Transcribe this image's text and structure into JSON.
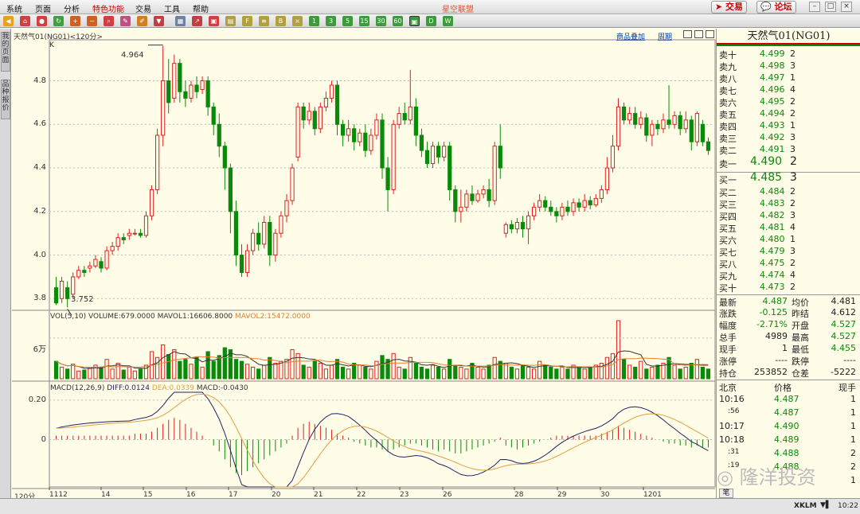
{
  "menu": {
    "items": [
      "系统",
      "页面",
      "分析",
      "特色功能",
      "交易",
      "工具",
      "帮助"
    ],
    "title": "星空联盟",
    "trade_btn": "交易",
    "forum_btn": "论坛"
  },
  "left_tabs": [
    "我的页面",
    "品种报价"
  ],
  "chart": {
    "title": "天然气01(NG01)<120分>",
    "k_label": "K",
    "links": [
      "商品叠加",
      "周期"
    ],
    "high_label": "4.964",
    "low_label": "3.752",
    "period_label": "120分",
    "price_ticks": [
      "4.8",
      "4.6",
      "4.4",
      "4.2",
      "4.0",
      "3.8"
    ],
    "x_labels": [
      "1112",
      "14",
      "15",
      "16",
      "17",
      "20",
      "21",
      "22",
      "23",
      "26",
      "28",
      "29",
      "30",
      "1201"
    ]
  },
  "volume": {
    "header_vol": "VOL(5,10) VOLUME:679.0000",
    "header_mavol1": "MAVOL1:16606.8000",
    "header_mavol2": "MAVOL2:15472.0000",
    "tick": "6万"
  },
  "macd": {
    "header_name": "MACD(12,26,9)",
    "header_diff": "DIFF:0.0124",
    "header_dea": "DEA:0.0339",
    "header_macd": "MACD:-0.0430",
    "ticks": [
      "0.20",
      "0"
    ]
  },
  "quote": {
    "title": "天然气01(NG01)",
    "sell": [
      {
        "label": "卖十",
        "price": "4.499",
        "qty": "2"
      },
      {
        "label": "卖九",
        "price": "4.498",
        "qty": "3"
      },
      {
        "label": "卖八",
        "price": "4.497",
        "qty": "1"
      },
      {
        "label": "卖七",
        "price": "4.496",
        "qty": "4"
      },
      {
        "label": "卖六",
        "price": "4.495",
        "qty": "2"
      },
      {
        "label": "卖五",
        "price": "4.494",
        "qty": "2"
      },
      {
        "label": "卖四",
        "price": "4.493",
        "qty": "1"
      },
      {
        "label": "卖三",
        "price": "4.492",
        "qty": "3"
      },
      {
        "label": "卖二",
        "price": "4.491",
        "qty": "3"
      },
      {
        "label": "卖一",
        "price": "4.490",
        "qty": "2"
      }
    ],
    "buy": [
      {
        "label": "买一",
        "price": "4.485",
        "qty": "3"
      },
      {
        "label": "买二",
        "price": "4.484",
        "qty": "2"
      },
      {
        "label": "买三",
        "price": "4.483",
        "qty": "2"
      },
      {
        "label": "买四",
        "price": "4.482",
        "qty": "3"
      },
      {
        "label": "买五",
        "price": "4.481",
        "qty": "4"
      },
      {
        "label": "买六",
        "price": "4.480",
        "qty": "1"
      },
      {
        "label": "买七",
        "price": "4.479",
        "qty": "3"
      },
      {
        "label": "买八",
        "price": "4.475",
        "qty": "2"
      },
      {
        "label": "买九",
        "price": "4.474",
        "qty": "4"
      },
      {
        "label": "买十",
        "price": "4.473",
        "qty": "2"
      }
    ],
    "stats": [
      {
        "l1": "最新",
        "v1": "4.487",
        "l2": "均价",
        "v2": "4.481"
      },
      {
        "l1": "涨跌",
        "v1": "-0.125",
        "l2": "昨结",
        "v2": "4.612"
      },
      {
        "l1": "幅度",
        "v1": "-2.71%",
        "l2": "开盘",
        "v2": "4.527"
      },
      {
        "l1": "总手",
        "v1": "4989",
        "l2": "最高",
        "v2": "4.527"
      },
      {
        "l1": "现手",
        "v1": "1",
        "l2": "最低",
        "v2": "4.455"
      },
      {
        "l1": "涨停",
        "v1": "----",
        "l2": "跌停",
        "v2": "----"
      },
      {
        "l1": "持仓",
        "v1": "253852",
        "l2": "仓差",
        "v2": "-5222"
      }
    ],
    "trades_header": {
      "time": "北京",
      "price": "价格",
      "qty": "现手"
    },
    "trades": [
      {
        "time": "10:16",
        "price": "4.487",
        "qty": "1"
      },
      {
        "time": ":56",
        "price": "4.487",
        "qty": "1"
      },
      {
        "time": "10:17",
        "price": "4.490",
        "qty": "1"
      },
      {
        "time": "10:18",
        "price": "4.489",
        "qty": "1"
      },
      {
        "time": ":31",
        "price": "4.488",
        "qty": "2"
      },
      {
        "time": ":19",
        "price": "4.488",
        "qty": "2"
      },
      {
        "time": "",
        "price": "",
        "qty": "1"
      }
    ],
    "tab": "笔"
  },
  "status": {
    "brand": "XKLM",
    "time": "10:22"
  },
  "watermark": "隆洋投资",
  "colors": {
    "up": "#e02020",
    "down": "#0a8a0a",
    "diff": "#222266",
    "dea": "#e0a040"
  },
  "chart_data": {
    "type": "candlestick",
    "price_ylim": [
      3.75,
      4.97
    ],
    "candles": [
      [
        3.85,
        3.78,
        3.9,
        3.77
      ],
      [
        3.8,
        3.88,
        3.9,
        3.78
      ],
      [
        3.85,
        3.8,
        3.88,
        3.76
      ],
      [
        3.82,
        3.9,
        3.92,
        3.8
      ],
      [
        3.9,
        3.93,
        3.95,
        3.89
      ],
      [
        3.93,
        3.92,
        3.95,
        3.9
      ],
      [
        3.94,
        3.95,
        3.97,
        3.92
      ],
      [
        3.95,
        3.98,
        4.0,
        3.94
      ],
      [
        3.97,
        3.94,
        3.99,
        3.92
      ],
      [
        3.94,
        4.02,
        4.04,
        3.93
      ],
      [
        4.02,
        4.04,
        4.06,
        4.0
      ],
      [
        4.04,
        4.08,
        4.1,
        4.02
      ],
      [
        4.08,
        4.07,
        4.1,
        4.05
      ],
      [
        4.09,
        4.1,
        4.12,
        4.07
      ],
      [
        4.1,
        4.1,
        4.12,
        4.09
      ],
      [
        4.1,
        4.09,
        4.12,
        4.08
      ],
      [
        4.09,
        4.18,
        4.2,
        4.08
      ],
      [
        4.18,
        4.3,
        4.32,
        4.16
      ],
      [
        4.3,
        4.55,
        4.58,
        4.28
      ],
      [
        4.55,
        4.8,
        4.96,
        4.5
      ],
      [
        4.8,
        4.7,
        4.9,
        4.65
      ],
      [
        4.72,
        4.88,
        4.92,
        4.7
      ],
      [
        4.88,
        4.75,
        4.9,
        4.7
      ],
      [
        4.75,
        4.72,
        4.8,
        4.68
      ],
      [
        4.72,
        4.78,
        4.8,
        4.7
      ],
      [
        4.78,
        4.75,
        4.82,
        4.72
      ],
      [
        4.76,
        4.8,
        4.82,
        4.74
      ],
      [
        4.8,
        4.68,
        4.82,
        4.64
      ],
      [
        4.68,
        4.6,
        4.7,
        4.55
      ],
      [
        4.6,
        4.5,
        4.65,
        4.45
      ],
      [
        4.5,
        4.4,
        4.52,
        4.3
      ],
      [
        4.4,
        4.2,
        4.42,
        4.1
      ],
      [
        4.2,
        4.0,
        4.25,
        3.95
      ],
      [
        4.0,
        3.92,
        4.05,
        3.9
      ],
      [
        3.92,
        4.02,
        4.05,
        3.9
      ],
      [
        4.02,
        4.1,
        4.12,
        4.0
      ],
      [
        4.1,
        4.05,
        4.15,
        4.02
      ],
      [
        4.05,
        4.15,
        4.18,
        4.03
      ],
      [
        4.15,
        4.0,
        4.18,
        3.95
      ],
      [
        4.0,
        4.1,
        4.12,
        3.97
      ],
      [
        4.1,
        4.18,
        4.2,
        4.08
      ],
      [
        4.18,
        4.25,
        4.28,
        4.15
      ],
      [
        4.25,
        4.4,
        4.42,
        4.23
      ],
      [
        4.45,
        4.68,
        4.7,
        4.43
      ],
      [
        4.68,
        4.62,
        4.7,
        4.58
      ],
      [
        4.62,
        4.66,
        4.7,
        4.6
      ],
      [
        4.66,
        4.58,
        4.68,
        4.55
      ],
      [
        4.58,
        4.68,
        4.7,
        4.56
      ],
      [
        4.68,
        4.72,
        4.75,
        4.66
      ],
      [
        4.72,
        4.78,
        4.8,
        4.7
      ],
      [
        4.78,
        4.6,
        4.8,
        4.55
      ],
      [
        4.6,
        4.55,
        4.62,
        4.5
      ],
      [
        4.55,
        4.58,
        4.62,
        4.52
      ],
      [
        4.58,
        4.52,
        4.6,
        4.48
      ],
      [
        4.52,
        4.56,
        4.58,
        4.5
      ],
      [
        4.56,
        4.48,
        4.6,
        4.45
      ],
      [
        4.48,
        4.55,
        4.58,
        4.46
      ],
      [
        4.55,
        4.62,
        4.65,
        4.53
      ],
      [
        4.62,
        4.4,
        4.65,
        4.35
      ],
      [
        4.4,
        4.3,
        4.45,
        4.2
      ],
      [
        4.3,
        4.6,
        4.62,
        4.28
      ],
      [
        4.6,
        4.65,
        4.68,
        4.58
      ],
      [
        4.65,
        4.62,
        4.7,
        4.6
      ],
      [
        4.62,
        4.68,
        4.85,
        4.6
      ],
      [
        4.68,
        4.55,
        4.72,
        4.5
      ],
      [
        4.55,
        4.48,
        4.58,
        4.45
      ],
      [
        4.48,
        4.42,
        4.52,
        4.4
      ],
      [
        4.42,
        4.5,
        4.52,
        4.4
      ],
      [
        4.5,
        4.45,
        4.52,
        4.42
      ],
      [
        4.45,
        4.5,
        4.52,
        4.43
      ],
      [
        4.5,
        4.3,
        4.52,
        4.25
      ],
      [
        4.3,
        4.2,
        4.32,
        4.15
      ],
      [
        4.2,
        4.22,
        4.3,
        4.15
      ],
      [
        4.22,
        4.28,
        4.3,
        4.2
      ],
      [
        4.28,
        4.25,
        4.32,
        4.23
      ],
      [
        4.25,
        4.28,
        4.3,
        4.24
      ],
      [
        4.28,
        4.3,
        4.32,
        4.26
      ],
      [
        4.3,
        4.25,
        4.35,
        4.22
      ],
      [
        4.25,
        4.5,
        4.52,
        4.23
      ],
      [
        4.5,
        4.4,
        4.6,
        4.35
      ],
      [
        4.1,
        4.14,
        4.15,
        4.08
      ],
      [
        4.14,
        4.12,
        4.16,
        4.1
      ],
      [
        4.12,
        4.15,
        4.17,
        4.1
      ],
      [
        4.15,
        4.12,
        4.18,
        4.08
      ],
      [
        4.12,
        4.18,
        4.2,
        4.05
      ],
      [
        4.18,
        4.22,
        4.24,
        4.16
      ],
      [
        4.22,
        4.25,
        4.28,
        4.2
      ],
      [
        4.25,
        4.22,
        4.27,
        4.2
      ],
      [
        4.22,
        4.2,
        4.25,
        4.18
      ],
      [
        4.2,
        4.18,
        4.22,
        4.15
      ],
      [
        4.18,
        4.22,
        4.24,
        4.16
      ],
      [
        4.22,
        4.2,
        4.25,
        4.18
      ],
      [
        4.2,
        4.24,
        4.26,
        4.18
      ],
      [
        4.24,
        4.22,
        4.26,
        4.2
      ],
      [
        4.22,
        4.25,
        4.28,
        4.2
      ],
      [
        4.25,
        4.23,
        4.27,
        4.21
      ],
      [
        4.23,
        4.26,
        4.28,
        4.22
      ],
      [
        4.26,
        4.3,
        4.32,
        4.24
      ],
      [
        4.3,
        4.4,
        4.45,
        4.28
      ],
      [
        4.4,
        4.5,
        4.55,
        4.38
      ],
      [
        4.5,
        4.68,
        4.72,
        4.48
      ],
      [
        4.68,
        4.62,
        4.7,
        4.6
      ],
      [
        4.62,
        4.65,
        4.68,
        4.6
      ],
      [
        4.65,
        4.6,
        4.68,
        4.58
      ],
      [
        4.6,
        4.63,
        4.66,
        4.58
      ],
      [
        4.63,
        4.55,
        4.65,
        4.52
      ],
      [
        4.55,
        4.6,
        4.62,
        4.5
      ],
      [
        4.6,
        4.58,
        4.62,
        4.55
      ],
      [
        4.58,
        4.62,
        4.65,
        4.56
      ],
      [
        4.62,
        4.6,
        4.78,
        4.58
      ],
      [
        4.6,
        4.64,
        4.66,
        4.58
      ],
      [
        4.64,
        4.58,
        4.66,
        4.55
      ],
      [
        4.58,
        4.62,
        4.66,
        4.56
      ],
      [
        4.62,
        4.52,
        4.64,
        4.48
      ],
      [
        4.52,
        4.65,
        4.66,
        4.5
      ],
      [
        4.6,
        4.52,
        4.62,
        4.5
      ],
      [
        4.52,
        4.48,
        4.54,
        4.46
      ]
    ],
    "volumes": [
      18,
      12,
      10,
      15,
      8,
      9,
      11,
      14,
      12,
      20,
      10,
      16,
      9,
      12,
      8,
      10,
      14,
      28,
      22,
      35,
      25,
      30,
      18,
      20,
      15,
      22,
      12,
      28,
      18,
      24,
      32,
      30,
      20,
      18,
      15,
      12,
      10,
      14,
      22,
      16,
      18,
      20,
      30,
      26,
      14,
      12,
      18,
      16,
      10,
      14,
      20,
      12,
      10,
      16,
      14,
      12,
      10,
      18,
      24,
      20,
      26,
      12,
      10,
      22,
      16,
      12,
      10,
      14,
      12,
      10,
      20,
      14,
      12,
      10,
      16,
      12,
      10,
      14,
      22,
      18,
      16,
      12,
      10,
      14,
      12,
      10,
      18,
      14,
      12,
      10,
      12,
      10,
      14,
      12,
      10,
      12,
      14,
      16,
      22,
      26,
      60,
      20,
      14,
      12,
      18,
      10,
      12,
      14,
      16,
      22,
      14,
      10,
      12,
      16,
      20,
      12,
      10
    ],
    "macd_bars": [
      0.02,
      0.02,
      0.02,
      0.02,
      0.02,
      0.02,
      0.02,
      0.02,
      0.02,
      0.02,
      0.02,
      0.02,
      0.02,
      0.02,
      0.03,
      0.03,
      0.03,
      0.04,
      0.06,
      0.08,
      0.1,
      0.11,
      0.1,
      0.08,
      0.06,
      0.04,
      0.02,
      0.0,
      -0.03,
      -0.06,
      -0.1,
      -0.14,
      -0.17,
      -0.18,
      -0.16,
      -0.14,
      -0.12,
      -0.1,
      -0.08,
      -0.06,
      -0.04,
      -0.02,
      0.02,
      0.06,
      0.08,
      0.09,
      0.08,
      0.07,
      0.06,
      0.05,
      0.03,
      0.02,
      0.01,
      -0.01,
      -0.02,
      -0.03,
      -0.04,
      -0.04,
      -0.05,
      -0.06,
      -0.05,
      -0.04,
      -0.03,
      -0.02,
      -0.02,
      -0.03,
      -0.04,
      -0.05,
      -0.06,
      -0.05,
      -0.06,
      -0.07,
      -0.07,
      -0.06,
      -0.05,
      -0.04,
      -0.03,
      -0.02,
      -0.01,
      0.01,
      -0.03,
      -0.04,
      -0.05,
      -0.04,
      -0.03,
      -0.02,
      -0.01,
      0.0,
      0.01,
      0.02,
      0.02,
      0.02,
      0.02,
      0.02,
      0.02,
      0.02,
      0.02,
      0.03,
      0.04,
      0.05,
      0.07,
      0.06,
      0.05,
      0.04,
      0.03,
      0.02,
      0.01,
      0.0,
      -0.01,
      -0.02,
      -0.02,
      -0.03,
      -0.03,
      -0.04,
      -0.03,
      -0.04,
      -0.04
    ],
    "macd_ylim": [
      -0.24,
      0.24
    ]
  }
}
